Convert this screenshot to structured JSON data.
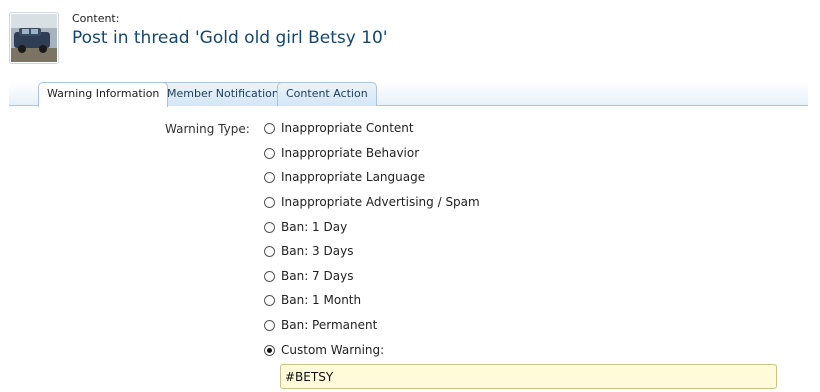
{
  "content": {
    "label": "Content:",
    "title": "Post in thread 'Gold old girl Betsy 10'"
  },
  "tabs": [
    {
      "label": "Warning Information",
      "active": true
    },
    {
      "label": "Member Notification",
      "active": false
    },
    {
      "label": "Content Action",
      "active": false
    }
  ],
  "warning": {
    "label": "Warning Type:",
    "options": [
      {
        "label": "Inappropriate Content",
        "checked": false
      },
      {
        "label": "Inappropriate Behavior",
        "checked": false
      },
      {
        "label": "Inappropriate Language",
        "checked": false
      },
      {
        "label": "Inappropriate Advertising / Spam",
        "checked": false
      },
      {
        "label": "Ban: 1 Day",
        "checked": false
      },
      {
        "label": "Ban: 3 Days",
        "checked": false
      },
      {
        "label": "Ban: 7 Days",
        "checked": false
      },
      {
        "label": "Ban: 1 Month",
        "checked": false
      },
      {
        "label": "Ban: Permanent",
        "checked": false
      },
      {
        "label": "Custom Warning:",
        "checked": true
      }
    ],
    "custom_value": "#BETSY"
  },
  "colors": {
    "title": "#15476e",
    "tab_border": "#a9c6dd",
    "input_bg": "#fffbd9"
  }
}
